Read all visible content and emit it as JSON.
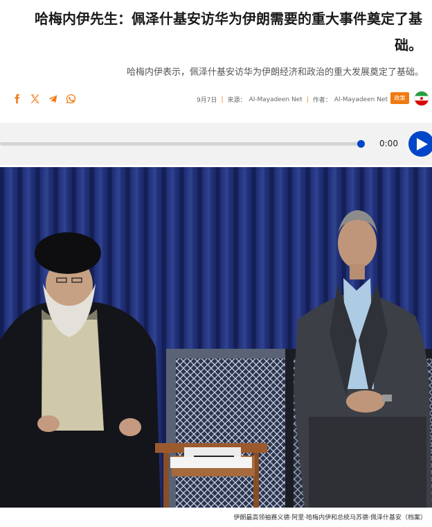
{
  "article": {
    "title": "哈梅内伊先生：佩泽什基安访华为伊朗需要的重大事件奠定了基础。",
    "subtitle": "哈梅内伊表示，佩泽什基安访华为伊朗经济和政治的重大发展奠定了基础。"
  },
  "share": {
    "icons": [
      "facebook-icon",
      "x-icon",
      "telegram-icon",
      "whatsapp-icon"
    ],
    "color": "#f07a10"
  },
  "meta": {
    "date": "9月7日",
    "source_label": "来源：",
    "source": "Al-Mayadeen Net",
    "author_label": "作者：",
    "author": "Al-Mayadeen Net",
    "category": "政策",
    "flag": "iran-flag-icon"
  },
  "player": {
    "time": "0:00",
    "progress": 1.0,
    "accent": "#0046c8"
  },
  "photo": {
    "caption": "伊朗最高领袖赛义德·阿里·哈梅内伊和总统马苏德·佩泽什基安（档案）"
  }
}
